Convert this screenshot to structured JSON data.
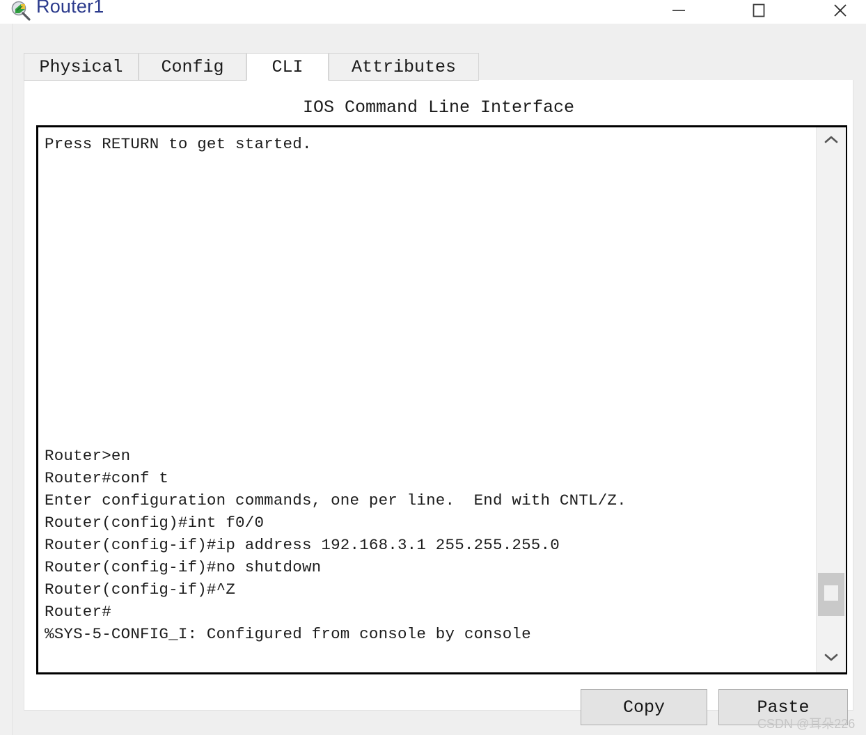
{
  "window": {
    "title": "Router1",
    "icon": "router-magnifier-icon",
    "controls": {
      "minimize": "minimize-icon",
      "maximize": "maximize-icon",
      "close": "close-icon"
    }
  },
  "tabs": [
    {
      "label": "Physical",
      "active": false
    },
    {
      "label": "Config",
      "active": false
    },
    {
      "label": "CLI",
      "active": true
    },
    {
      "label": "Attributes",
      "active": false
    }
  ],
  "panel": {
    "header": "IOS Command Line Interface"
  },
  "terminal": {
    "lines": [
      "Press RETURN to get started.",
      "",
      "",
      "",
      "",
      "",
      "",
      "",
      "",
      "",
      "",
      "",
      "",
      "",
      "Router>en",
      "Router#conf t",
      "Enter configuration commands, one per line.  End with CNTL/Z.",
      "Router(config)#int f0/0",
      "Router(config-if)#ip address 192.168.3.1 255.255.255.0",
      "Router(config-if)#no shutdown",
      "Router(config-if)#^Z",
      "Router#",
      "%SYS-5-CONFIG_I: Configured from console by console"
    ],
    "scrollbar": {
      "up_arrow": "chevron-up-icon",
      "down_arrow": "chevron-down-icon"
    }
  },
  "buttons": {
    "copy": "Copy",
    "paste": "Paste"
  },
  "watermark": "CSDN @耳朵226",
  "colors": {
    "title_text": "#2b3a8c",
    "panel_bg": "#efefef",
    "tab_active_bg": "#ffffff",
    "tab_inactive_bg": "#f0f0f0",
    "terminal_bg": "#ffffff",
    "terminal_border": "#000000",
    "button_bg": "#e3e3e3",
    "scrollbar_thumb": "#c9c9c9"
  }
}
